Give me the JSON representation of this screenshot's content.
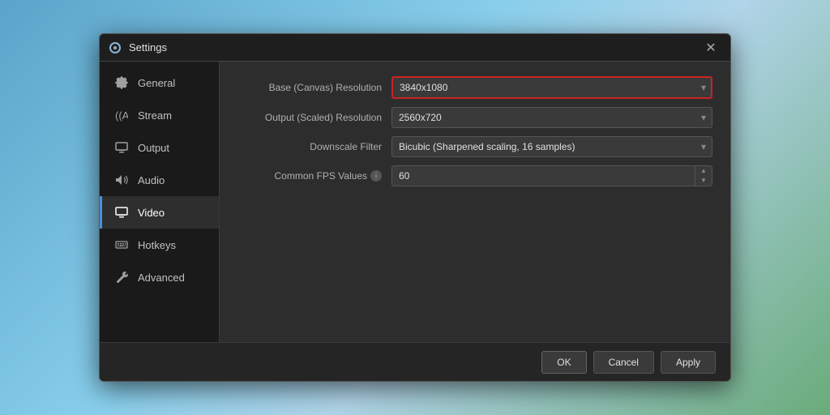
{
  "dialog": {
    "title": "Settings",
    "close_label": "✕"
  },
  "sidebar": {
    "items": [
      {
        "id": "general",
        "label": "General",
        "icon": "gear"
      },
      {
        "id": "stream",
        "label": "Stream",
        "icon": "wifi"
      },
      {
        "id": "output",
        "label": "Output",
        "icon": "monitor-out"
      },
      {
        "id": "audio",
        "label": "Audio",
        "icon": "speaker"
      },
      {
        "id": "video",
        "label": "Video",
        "icon": "monitor",
        "active": true
      },
      {
        "id": "hotkeys",
        "label": "Hotkeys",
        "icon": "keyboard"
      },
      {
        "id": "advanced",
        "label": "Advanced",
        "icon": "wrench"
      }
    ]
  },
  "main": {
    "rows": [
      {
        "id": "base-resolution",
        "label": "Base (Canvas) Resolution",
        "value": "3840x1080",
        "type": "select",
        "highlighted": true
      },
      {
        "id": "output-resolution",
        "label": "Output (Scaled) Resolution",
        "value": "2560x720",
        "type": "select",
        "highlighted": false
      },
      {
        "id": "downscale-filter",
        "label": "Downscale Filter",
        "value": "Bicubic (Sharpened scaling, 16 samples)",
        "type": "select",
        "highlighted": false
      },
      {
        "id": "fps",
        "label": "Common FPS Values",
        "value": "60",
        "type": "spinner",
        "highlighted": false
      }
    ]
  },
  "footer": {
    "ok_label": "OK",
    "cancel_label": "Cancel",
    "apply_label": "Apply"
  }
}
